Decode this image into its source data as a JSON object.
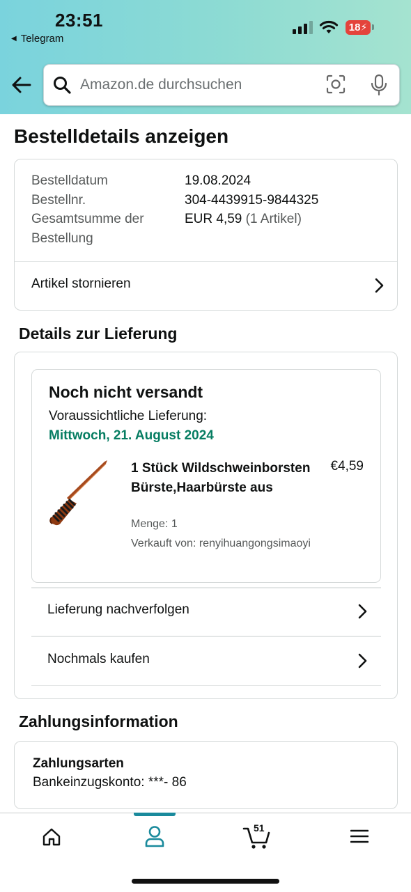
{
  "status_bar": {
    "time": "23:51",
    "back_app": "Telegram",
    "battery": "18"
  },
  "search": {
    "placeholder": "Amazon.de durchsuchen"
  },
  "page_title": "Bestelldetails anzeigen",
  "summary": {
    "date_label": "Bestelldatum",
    "date_value": "19.08.2024",
    "number_label": "Bestellnr.",
    "number_value": "304-4439915-9844325",
    "total_label_1": "Gesamtsumme der",
    "total_label_2": "Bestellung",
    "total_value": "EUR 4,59",
    "total_items": "(1 Artikel)",
    "cancel_label": "Artikel stornieren"
  },
  "delivery": {
    "section_title": "Details zur Lieferung",
    "status": "Noch nicht versandt",
    "eta_label": "Voraussichtliche Lieferung:",
    "eta_date": "Mittwoch, 21. August 2024",
    "item": {
      "title": "1 Stück Wildschweinborsten Bürste,Haarbürste aus",
      "price": "€4,59",
      "quantity": "Menge: 1",
      "seller": "Verkauft von: renyihuangongsimaoyi"
    },
    "track_label": "Lieferung nachverfolgen",
    "buy_again_label": "Nochmals kaufen"
  },
  "payment": {
    "section_title": "Zahlungsinformation",
    "methods_title": "Zahlungsarten",
    "method_value": "Bankeinzugskonto: ***- 86"
  },
  "tabbar": {
    "active": "account",
    "cart_count": "51",
    "accent_color": "#1a8a9c"
  },
  "colors": {
    "header_gradient_start": "#7ad3dd",
    "header_gradient_end": "#a5e3d0",
    "eta_green": "#067d62",
    "battery_red": "#e4433b"
  },
  "icons": [
    "back-arrow-icon",
    "search-icon",
    "camera-lens-icon",
    "microphone-icon",
    "chevron-right-icon",
    "home-icon",
    "account-icon",
    "cart-icon",
    "menu-icon",
    "signal-icon",
    "wifi-icon",
    "battery-charging-icon"
  ]
}
